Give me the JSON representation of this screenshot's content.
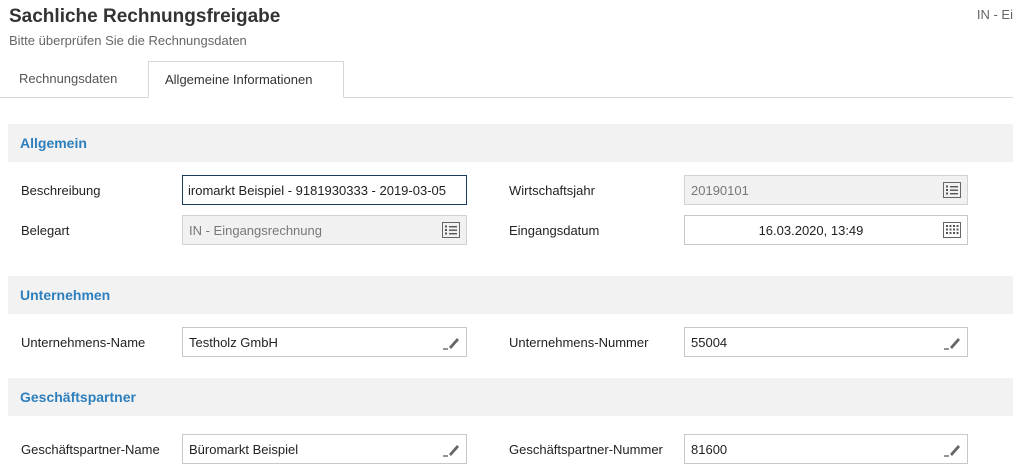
{
  "header": {
    "title": "Sachliche Rechnungsfreigabe",
    "subtitle": "Bitte überprüfen Sie die Rechnungsdaten",
    "right_text": "IN - Ei"
  },
  "tabs": [
    {
      "label": "Rechnungsdaten",
      "active": false
    },
    {
      "label": "Allgemeine Informationen",
      "active": true
    }
  ],
  "sections": {
    "allgemein": {
      "title": "Allgemein",
      "beschreibung": {
        "label": "Beschreibung",
        "value": "iromarkt Beispiel - 9181930333 - 2019-03-05"
      },
      "wirtschaftsjahr": {
        "label": "Wirtschaftsjahr",
        "value": "20190101",
        "icon": "list-icon"
      },
      "belegart": {
        "label": "Belegart",
        "value": "IN - Eingangsrechnung",
        "icon": "list-icon"
      },
      "eingangsdatum": {
        "label": "Eingangsdatum",
        "value": "16.03.2020, 13:49",
        "icon": "calendar-icon"
      }
    },
    "unternehmen": {
      "title": "Unternehmen",
      "name": {
        "label": "Unternehmens-Name",
        "value": "Testholz GmbH",
        "icon": "pencil-icon"
      },
      "nummer": {
        "label": "Unternehmens-Nummer",
        "value": "55004",
        "icon": "pencil-icon"
      }
    },
    "geschaeftspartner": {
      "title": "Geschäftspartner",
      "name": {
        "label": "Geschäftspartner-Name",
        "value": "Büromarkt Beispiel",
        "icon": "pencil-icon"
      },
      "nummer": {
        "label": "Geschäftspartner-Nummer",
        "value": "81600",
        "icon": "pencil-icon"
      }
    }
  },
  "colors": {
    "section_title": "#2d7fbd",
    "section_bg": "#f2f2f2",
    "readonly_bg": "#f1f1f1"
  }
}
